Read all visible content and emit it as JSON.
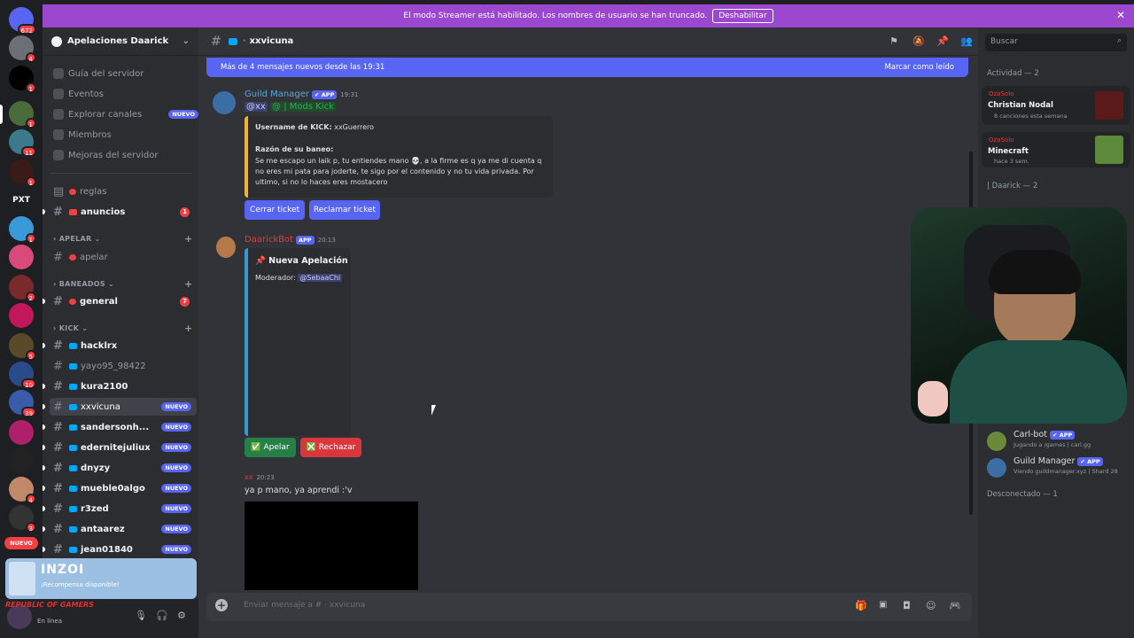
{
  "rail": {
    "badges": [
      "672",
      "4",
      "1",
      "1",
      "11",
      "1",
      "1",
      "3",
      "2",
      "11",
      "5",
      "10",
      "39",
      "6",
      "4",
      "3",
      "6"
    ],
    "pxt_label": "PXT",
    "nuevo_label": "NUEVO"
  },
  "banner": {
    "text": "El modo Streamer está habilitado. Los nombres de usuario se han truncado.",
    "disable_label": "Deshabilitar",
    "close_icon": "✕"
  },
  "sidebar": {
    "server_name": "Apelaciones Daarick",
    "nav": [
      "Guía del servidor",
      "Eventos",
      "Explorar canales",
      "Miembros",
      "Mejoras del servidor"
    ],
    "explore_tag": "NUEVO",
    "channels_top": [
      {
        "name": "reglas",
        "count": ""
      },
      {
        "name": "anuncios",
        "count": "1"
      }
    ],
    "cat_apelar": "APELAR",
    "ch_apelar": "apelar",
    "cat_baneados": "BANEADOS",
    "ch_general": "general",
    "ch_general_count": "7",
    "cat_kick": "KICK",
    "kick_channels": [
      {
        "name": "hacklrx",
        "tag": ""
      },
      {
        "name": "yayo95_98422",
        "tag": ""
      },
      {
        "name": "kura2100",
        "tag": ""
      },
      {
        "name": "xxvicuna",
        "tag": "NUEVO"
      },
      {
        "name": "sandersonh...",
        "tag": "NUEVO"
      },
      {
        "name": "edernitejuliux",
        "tag": "NUEVO"
      },
      {
        "name": "dnyzy",
        "tag": "NUEVO"
      },
      {
        "name": "mueble0algo",
        "tag": "NUEVO"
      },
      {
        "name": "r3zed",
        "tag": "NUEVO"
      },
      {
        "name": "antaarez",
        "tag": "NUEVO"
      },
      {
        "name": "jean01840",
        "tag": "NUEVO"
      }
    ],
    "promo_title": "INZOI",
    "promo_sub": "¡Recompensa disponible!",
    "user_status": "En línea",
    "rog_text": "REPUBLIC OF GAMERS"
  },
  "main": {
    "channel": "xxvicuna",
    "new_messages": "Más de 4 mensajes nuevos desde las 19:31",
    "mark_read": "Marcar como leído",
    "msg1": {
      "author": "Guild Manager",
      "badge": "✔ APP",
      "time": "19:31",
      "mention_user": "@xx",
      "mention_role": "@ | Mods Kick",
      "embed_field1_label": "Username de KICK:",
      "embed_field1_value": "xxGuerrero",
      "embed_field2_label": "Razón de su baneo:",
      "embed_field2_value": "Se me escapo un laik p, tu entiendes mano 💀, a la firme es q ya me di cuenta q no eres mi pata para joderte, te sigo por el contenido y no tu vida privada. Por ultimo, si no lo haces eres mostacero",
      "btn_close": "Cerrar ticket",
      "btn_claim": "Reclamar ticket"
    },
    "msg2": {
      "author": "DaarickBot",
      "badge": "APP",
      "time": "20:13",
      "embed_title": "📌 Nueva Apelación",
      "moderator_label": "Moderador:",
      "moderator_value": "@SebaaChi",
      "btn_appeal": "✅ Apelar",
      "btn_reject": "❎ Rechazar"
    },
    "msg3": {
      "author": "xx",
      "time": "20:23",
      "text": "ya p mano, ya aprendi :'v"
    },
    "composer_placeholder": "Enviar mensaje a #   ·  xxvicuna"
  },
  "right": {
    "search_placeholder": "Buscar",
    "activity_header": "Actividad — 2",
    "activities": [
      {
        "user": "OzaSolo",
        "title": "Christian Nodal",
        "sub": "8 canciones esta semana"
      },
      {
        "user": "OzaSolo",
        "title": "Minecraft",
        "sub": "hace 3 sem."
      }
    ],
    "group_daarick": "| Daarick — 2",
    "members": [
      {
        "name": "Carl-bot",
        "badge": "✔ APP",
        "status": "Jugando a /games | carl.gg"
      },
      {
        "name": "Guild Manager",
        "badge": "✔ APP",
        "status": "Viendo guildmanager.xyz | Shard 28"
      }
    ],
    "offline_header": "Desconectado — 1"
  },
  "colors": {
    "blurple": "#5865f2",
    "green": "#248046",
    "red": "#da373c",
    "streamer": "#9c47d0",
    "yellow_bar": "#f0b232",
    "blue_bar": "#3498db"
  }
}
